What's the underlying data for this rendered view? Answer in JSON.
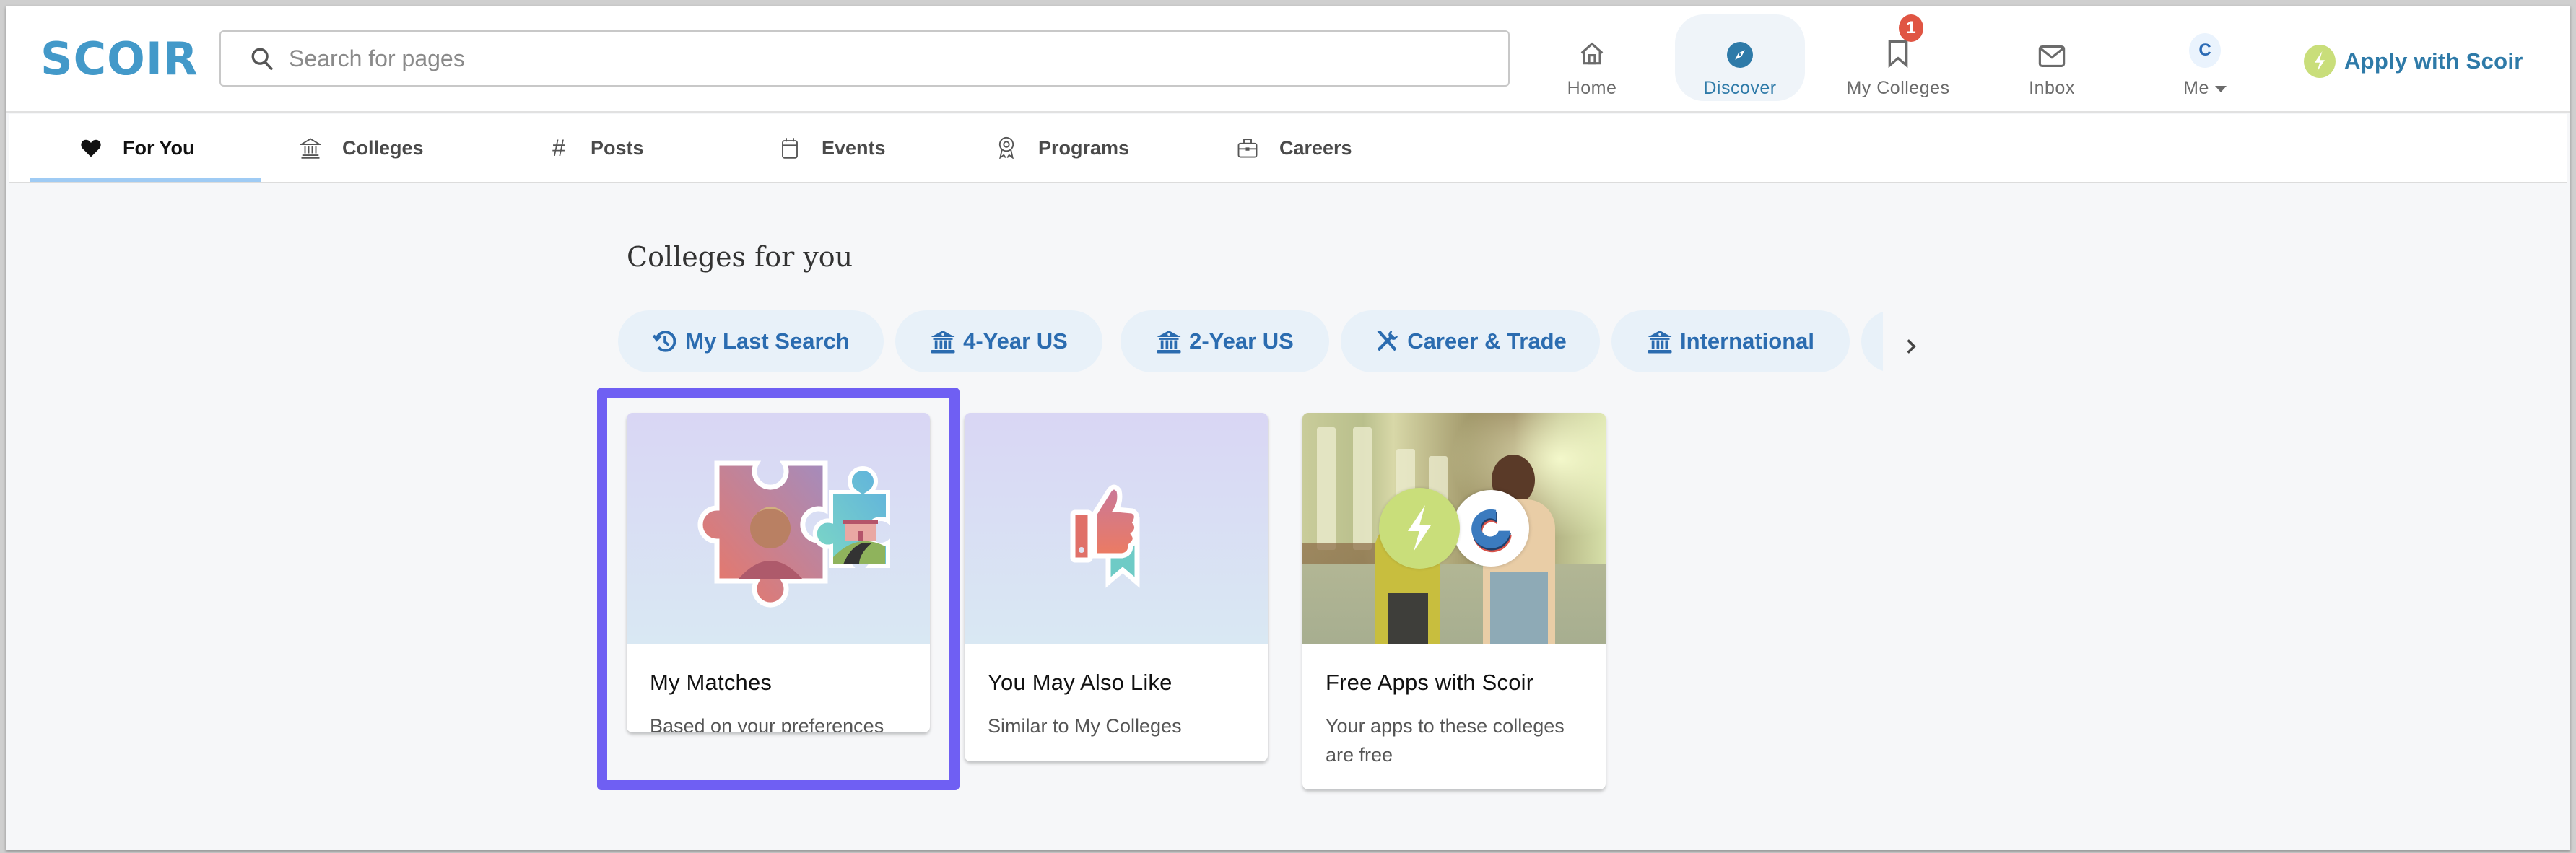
{
  "header": {
    "logo_text": "SCOIR",
    "search": {
      "placeholder": "Search for pages",
      "value": ""
    },
    "nav": [
      {
        "id": "home",
        "label": "Home",
        "icon": "home-icon"
      },
      {
        "id": "discover",
        "label": "Discover",
        "icon": "compass-icon",
        "active": true
      },
      {
        "id": "my-colleges",
        "label": "My Colleges",
        "icon": "bookmark-icon",
        "badge": "1"
      },
      {
        "id": "inbox",
        "label": "Inbox",
        "icon": "envelope-icon"
      },
      {
        "id": "me",
        "label": "Me",
        "icon": "avatar",
        "avatar_initial": "C"
      }
    ],
    "apply_button": {
      "label": "Apply with Scoir",
      "icon": "lightning-icon"
    }
  },
  "tabs": [
    {
      "label": "For You",
      "icon": "heart-icon",
      "active": true
    },
    {
      "label": "Colleges",
      "icon": "institution-icon"
    },
    {
      "label": "Posts",
      "icon": "hash-icon"
    },
    {
      "label": "Events",
      "icon": "calendar-icon"
    },
    {
      "label": "Programs",
      "icon": "award-icon"
    },
    {
      "label": "Careers",
      "icon": "briefcase-icon"
    }
  ],
  "main": {
    "heading": "Colleges for you",
    "chips": [
      {
        "label": "My Last Search",
        "icon": "history-icon"
      },
      {
        "label": "4-Year US",
        "icon": "institution-icon"
      },
      {
        "label": "2-Year US",
        "icon": "institution-icon"
      },
      {
        "label": "Career & Trade",
        "icon": "tools-icon"
      },
      {
        "label": "International",
        "icon": "institution-icon"
      }
    ],
    "cards": [
      {
        "title": "My Matches",
        "subtitle": "Based on your preferences",
        "highlighted": true
      },
      {
        "title": "You May Also Like",
        "subtitle": "Similar to My Colleges"
      },
      {
        "title": "Free Apps with Scoir",
        "subtitle": "Your apps to these colleges are free"
      }
    ]
  },
  "colors": {
    "brand": "#4399c9",
    "accent": "#2e7aa8",
    "chip_text": "#2b6cb0",
    "chip_bg": "#e8f1f9",
    "badge": "#e05543",
    "highlight": "#6f5ff3",
    "apply_green": "#c9de7a"
  }
}
